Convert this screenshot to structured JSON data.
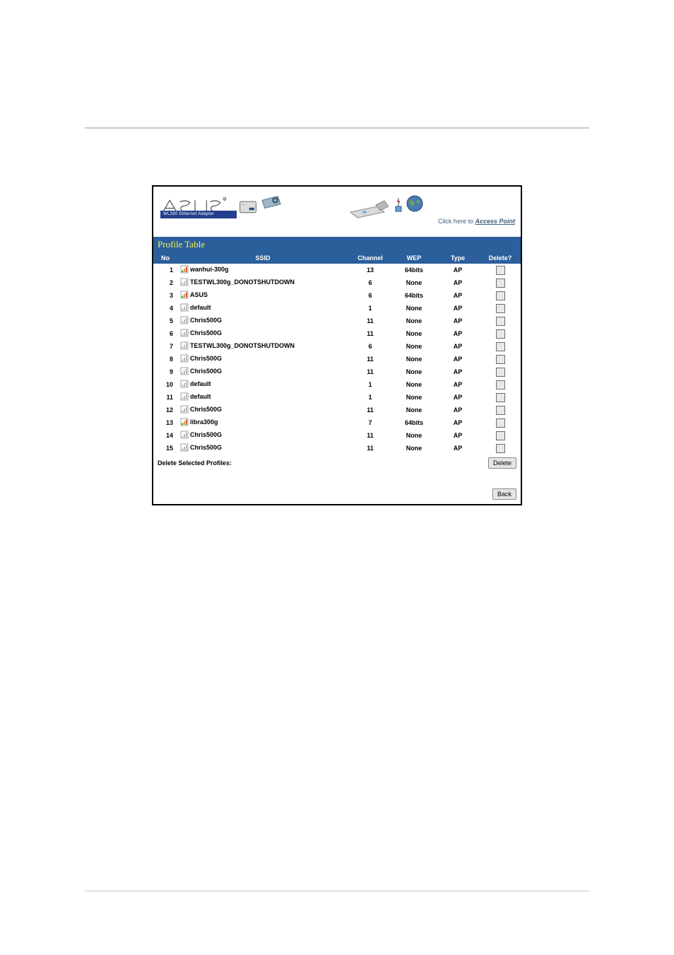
{
  "banner": {
    "product_label": "WL330 Ethernet Adapter",
    "ap_link_prefix": "Click here to ",
    "ap_link_text": "Access Point",
    "icons": {
      "logo": "asus-logo",
      "adapter": "adapter-icon",
      "cardbus": "cardbus-icon",
      "dongle": "dongle-icon",
      "ap_tower": "ap-tower-icon",
      "globe": "globe-icon"
    }
  },
  "section_title": "Profile Table",
  "headers": {
    "no": "No",
    "ssid": "SSID",
    "channel": "Channel",
    "wep": "WEP",
    "type": "Type",
    "del": "Delete?"
  },
  "rows": [
    {
      "no": "1",
      "ssid": "wanhui-300g",
      "signal": "4",
      "channel": "13",
      "wep": "64bits",
      "type": "AP"
    },
    {
      "no": "2",
      "ssid": "TESTWL300g_DONOTSHUTDOWN",
      "signal": "0",
      "channel": "6",
      "wep": "None",
      "type": "AP"
    },
    {
      "no": "3",
      "ssid": "ASUS",
      "signal": "4",
      "channel": "6",
      "wep": "64bits",
      "type": "AP"
    },
    {
      "no": "4",
      "ssid": "default",
      "signal": "0",
      "channel": "1",
      "wep": "None",
      "type": "AP"
    },
    {
      "no": "5",
      "ssid": "Chris500G",
      "signal": "0",
      "channel": "11",
      "wep": "None",
      "type": "AP"
    },
    {
      "no": "6",
      "ssid": "Chris500G",
      "signal": "0",
      "channel": "11",
      "wep": "None",
      "type": "AP"
    },
    {
      "no": "7",
      "ssid": "TESTWL300g_DONOTSHUTDOWN",
      "signal": "0",
      "channel": "6",
      "wep": "None",
      "type": "AP"
    },
    {
      "no": "8",
      "ssid": "Chris500G",
      "signal": "0",
      "channel": "11",
      "wep": "None",
      "type": "AP"
    },
    {
      "no": "9",
      "ssid": "Chris500G",
      "signal": "0",
      "channel": "11",
      "wep": "None",
      "type": "AP"
    },
    {
      "no": "10",
      "ssid": "default",
      "signal": "0",
      "channel": "1",
      "wep": "None",
      "type": "AP"
    },
    {
      "no": "11",
      "ssid": "default",
      "signal": "0",
      "channel": "1",
      "wep": "None",
      "type": "AP"
    },
    {
      "no": "12",
      "ssid": "Chris500G",
      "signal": "0",
      "channel": "11",
      "wep": "None",
      "type": "AP"
    },
    {
      "no": "13",
      "ssid": "libra300g",
      "signal": "4",
      "channel": "7",
      "wep": "64bits",
      "type": "AP"
    },
    {
      "no": "14",
      "ssid": "Chris500G",
      "signal": "0",
      "channel": "11",
      "wep": "None",
      "type": "AP"
    },
    {
      "no": "15",
      "ssid": "Chris500G",
      "signal": "0",
      "channel": "11",
      "wep": "None",
      "type": "AP"
    }
  ],
  "footer": {
    "delete_label": "Delete Selected Profiles:",
    "delete_button": "Delete",
    "back_button": "Back"
  }
}
